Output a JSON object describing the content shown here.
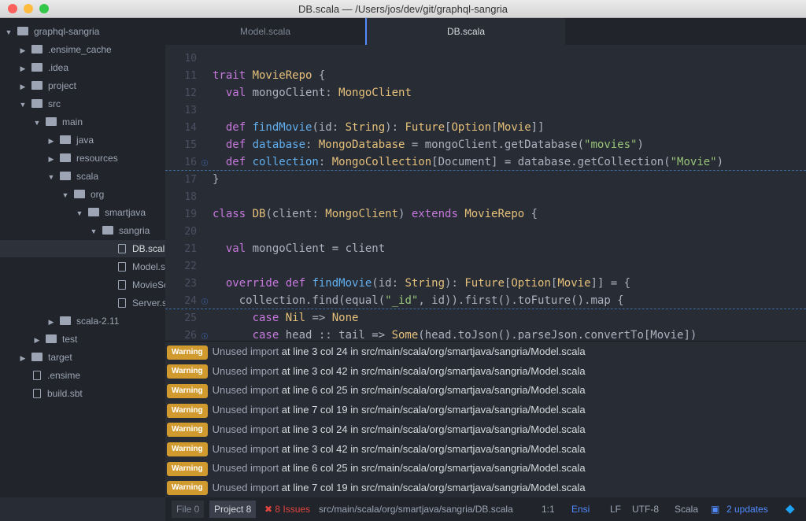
{
  "window": {
    "title": "DB.scala — /Users/jos/dev/git/graphql-sangria"
  },
  "tree": [
    {
      "label": "graphql-sangria",
      "level": 0,
      "type": "folder",
      "open": true
    },
    {
      "label": ".ensime_cache",
      "level": 1,
      "type": "folder",
      "open": false
    },
    {
      "label": ".idea",
      "level": 1,
      "type": "folder",
      "open": false
    },
    {
      "label": "project",
      "level": 1,
      "type": "folder",
      "open": false
    },
    {
      "label": "src",
      "level": 1,
      "type": "folder",
      "open": true
    },
    {
      "label": "main",
      "level": 2,
      "type": "folder",
      "open": true
    },
    {
      "label": "java",
      "level": 3,
      "type": "folder",
      "open": false
    },
    {
      "label": "resources",
      "level": 3,
      "type": "folder",
      "open": false
    },
    {
      "label": "scala",
      "level": 3,
      "type": "folder",
      "open": true
    },
    {
      "label": "org",
      "level": 4,
      "type": "folder",
      "open": true
    },
    {
      "label": "smartjava",
      "level": 5,
      "type": "folder",
      "open": true
    },
    {
      "label": "sangria",
      "level": 6,
      "type": "folder",
      "open": true
    },
    {
      "label": "DB.scala",
      "level": 7,
      "type": "file",
      "selected": true
    },
    {
      "label": "Model.scala",
      "level": 7,
      "type": "file"
    },
    {
      "label": "MovieSchema.scala",
      "level": 7,
      "type": "file"
    },
    {
      "label": "Server.scala",
      "level": 7,
      "type": "file"
    },
    {
      "label": "scala-2.11",
      "level": 3,
      "type": "folder",
      "open": false
    },
    {
      "label": "test",
      "level": 2,
      "type": "folder",
      "open": false
    },
    {
      "label": "target",
      "level": 1,
      "type": "folder",
      "open": false
    },
    {
      "label": ".ensime",
      "level": 1,
      "type": "file"
    },
    {
      "label": "build.sbt",
      "level": 1,
      "type": "file"
    }
  ],
  "tabs": [
    {
      "label": "Model.scala",
      "active": false
    },
    {
      "label": "DB.scala",
      "active": true
    }
  ],
  "code": [
    {
      "n": "10",
      "tokens": []
    },
    {
      "n": "11",
      "tokens": [
        [
          "trait ",
          "k"
        ],
        [
          "MovieRepo",
          "t"
        ],
        [
          " {",
          ""
        ]
      ]
    },
    {
      "n": "12",
      "tokens": [
        [
          "  val ",
          "k"
        ],
        [
          "mongoClient: ",
          ""
        ],
        [
          "MongoClient",
          "t"
        ]
      ]
    },
    {
      "n": "13",
      "tokens": []
    },
    {
      "n": "14",
      "tokens": [
        [
          "  def ",
          "k"
        ],
        [
          "findMovie",
          "f"
        ],
        [
          "(id: ",
          ""
        ],
        [
          "String",
          "t"
        ],
        [
          "): ",
          ""
        ],
        [
          "Future",
          "t"
        ],
        [
          "[",
          ""
        ],
        [
          "Option",
          "t"
        ],
        [
          "[",
          ""
        ],
        [
          "Movie",
          "t"
        ],
        [
          "]]",
          ""
        ]
      ]
    },
    {
      "n": "15",
      "tokens": [
        [
          "  def ",
          "k"
        ],
        [
          "database",
          "f"
        ],
        [
          ": ",
          ""
        ],
        [
          "MongoDatabase",
          "t"
        ],
        [
          " = mongoClient.getDatabase(",
          ""
        ],
        [
          "\"movies\"",
          "s"
        ],
        [
          ")",
          ""
        ]
      ]
    },
    {
      "n": "16",
      "info": true,
      "tokens": [
        [
          "  def ",
          "k"
        ],
        [
          "collection",
          "f"
        ],
        [
          ": ",
          ""
        ],
        [
          "MongoCollection",
          "t"
        ],
        [
          "[Document] = database.getCollection(",
          ""
        ],
        [
          "\"Movie\"",
          "s"
        ],
        [
          ")",
          ""
        ]
      ]
    },
    {
      "n": "17",
      "tokens": [
        [
          "}",
          ""
        ]
      ]
    },
    {
      "n": "18",
      "tokens": []
    },
    {
      "n": "19",
      "tokens": [
        [
          "class ",
          "k"
        ],
        [
          "DB",
          "t"
        ],
        [
          "(client: ",
          ""
        ],
        [
          "MongoClient",
          "t"
        ],
        [
          ") ",
          ""
        ],
        [
          "extends ",
          "k"
        ],
        [
          "MovieRepo",
          "t"
        ],
        [
          " {",
          ""
        ]
      ]
    },
    {
      "n": "20",
      "tokens": []
    },
    {
      "n": "21",
      "tokens": [
        [
          "  val ",
          "k"
        ],
        [
          "mongoClient = client",
          ""
        ]
      ]
    },
    {
      "n": "22",
      "tokens": []
    },
    {
      "n": "23",
      "tokens": [
        [
          "  override def ",
          "k"
        ],
        [
          "findMovie",
          "f"
        ],
        [
          "(id: ",
          ""
        ],
        [
          "String",
          "t"
        ],
        [
          "): ",
          ""
        ],
        [
          "Future",
          "t"
        ],
        [
          "[",
          ""
        ],
        [
          "Option",
          "t"
        ],
        [
          "[",
          ""
        ],
        [
          "Movie",
          "t"
        ],
        [
          "]] = {",
          ""
        ]
      ]
    },
    {
      "n": "24",
      "info": true,
      "tokens": [
        [
          "    collection.find(equal(",
          ""
        ],
        [
          "\"_id\"",
          "s"
        ],
        [
          ", id)).first().toFuture().map {",
          ""
        ]
      ]
    },
    {
      "n": "25",
      "tokens": [
        [
          "      case ",
          "k"
        ],
        [
          "Nil",
          "t"
        ],
        [
          " => ",
          ""
        ],
        [
          "None",
          "t"
        ]
      ]
    },
    {
      "n": "26",
      "info": true,
      "tokens": [
        [
          "      case ",
          "k"
        ],
        [
          "head :: tail => ",
          ""
        ],
        [
          "Some",
          "t"
        ],
        [
          "(head.toJson().parseJson.convertTo[Movie])",
          ""
        ]
      ]
    }
  ],
  "issues": [
    {
      "badge": "Warning",
      "msg": "Unused import",
      "loc": " at line 3 col 24 in src/main/scala/org/smartjava/sangria/Model.scala"
    },
    {
      "badge": "Warning",
      "msg": "Unused import",
      "loc": " at line 3 col 42 in src/main/scala/org/smartjava/sangria/Model.scala"
    },
    {
      "badge": "Warning",
      "msg": "Unused import",
      "loc": " at line 6 col 25 in src/main/scala/org/smartjava/sangria/Model.scala"
    },
    {
      "badge": "Warning",
      "msg": "Unused import",
      "loc": " at line 7 col 19 in src/main/scala/org/smartjava/sangria/Model.scala"
    },
    {
      "badge": "Warning",
      "msg": "Unused import",
      "loc": " at line 3 col 24 in src/main/scala/org/smartjava/sangria/Model.scala"
    },
    {
      "badge": "Warning",
      "msg": "Unused import",
      "loc": " at line 3 col 42 in src/main/scala/org/smartjava/sangria/Model.scala"
    },
    {
      "badge": "Warning",
      "msg": "Unused import",
      "loc": " at line 6 col 25 in src/main/scala/org/smartjava/sangria/Model.scala"
    },
    {
      "badge": "Warning",
      "msg": "Unused import",
      "loc": " at line 7 col 19 in src/main/scala/org/smartjava/sangria/Model.scala"
    }
  ],
  "status": {
    "file_tab": "File 0",
    "project_tab": "Project 8",
    "issues": "✖ 8 Issues",
    "path": "src/main/scala/org/smartjava/sangria/DB.scala",
    "cursor": "1:1",
    "ensime": "Ensi",
    "eol": "LF",
    "encoding": "UTF-8",
    "grammar": "Scala",
    "updates": "2 updates"
  },
  "colors": {
    "warning": "#d19a2e",
    "error": "#e0443e",
    "link": "#528bff"
  }
}
